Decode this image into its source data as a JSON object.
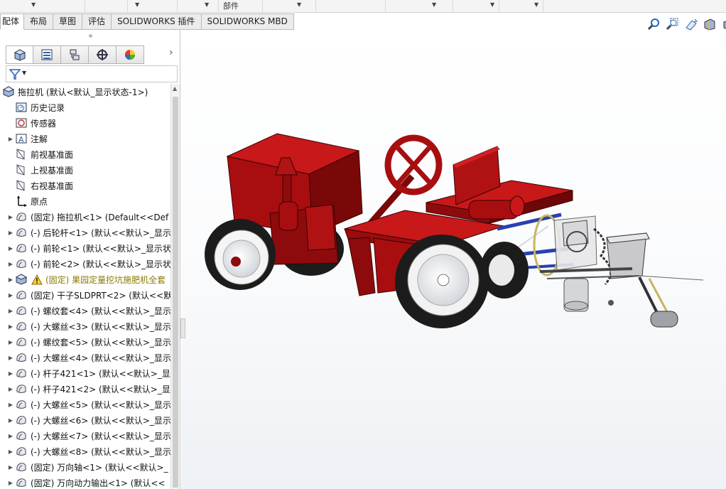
{
  "ribbon": {
    "partial_label": "部件"
  },
  "tabs": [
    "配体",
    "布局",
    "草图",
    "评估",
    "SOLIDWORKS 插件",
    "SOLIDWORKS MBD"
  ],
  "panel_tabs": [
    "feature-manager",
    "property-manager",
    "configuration-manager",
    "dimxpert-manager",
    "display-manager"
  ],
  "tree": [
    {
      "label": "拖拉机  (默认<默认_显示状态-1>)",
      "icon": "assembly-icon",
      "expander": "collapse"
    },
    {
      "label": "历史记录",
      "icon": "history-folder-icon",
      "expander": ""
    },
    {
      "label": "传感器",
      "icon": "sensor-icon",
      "expander": ""
    },
    {
      "label": "注解",
      "icon": "annotation-icon",
      "expander": "expand"
    },
    {
      "label": "前视基准面",
      "icon": "plane-icon",
      "expander": ""
    },
    {
      "label": "上视基准面",
      "icon": "plane-icon",
      "expander": ""
    },
    {
      "label": "右视基准面",
      "icon": "plane-icon",
      "expander": ""
    },
    {
      "label": "原点",
      "icon": "origin-icon",
      "expander": ""
    },
    {
      "label": "(固定) 拖拉机<1> (Default<<Def",
      "icon": "part-icon",
      "expander": "expand"
    },
    {
      "label": "(-) 后轮杆<1> (默认<<默认>_显示",
      "icon": "part-icon",
      "expander": "expand"
    },
    {
      "label": "(-) 前轮<1> (默认<<默认>_显示状",
      "icon": "part-icon",
      "expander": "expand"
    },
    {
      "label": "(-) 前轮<2> (默认<<默认>_显示状",
      "icon": "part-icon",
      "expander": "expand"
    },
    {
      "label": "(固定) 果园定量挖坑施肥机全套",
      "icon": "subassembly-icon",
      "expander": "expand",
      "warning": true
    },
    {
      "label": "(固定) 干子SLDPRT<2> (默认<<默",
      "icon": "part-icon",
      "expander": "expand"
    },
    {
      "label": "(-) 螺纹套<4> (默认<<默认>_显示",
      "icon": "part-icon",
      "expander": "expand"
    },
    {
      "label": "(-) 大螺丝<3> (默认<<默认>_显示",
      "icon": "part-icon",
      "expander": "expand"
    },
    {
      "label": "(-) 螺纹套<5> (默认<<默认>_显示",
      "icon": "part-icon",
      "expander": "expand"
    },
    {
      "label": "(-) 大螺丝<4> (默认<<默认>_显示",
      "icon": "part-icon",
      "expander": "expand"
    },
    {
      "label": "(-) 杆子421<1> (默认<<默认>_显",
      "icon": "part-icon",
      "expander": "expand"
    },
    {
      "label": "(-) 杆子421<2> (默认<<默认>_显",
      "icon": "part-icon",
      "expander": "expand"
    },
    {
      "label": "(-) 大螺丝<5> (默认<<默认>_显示",
      "icon": "part-icon",
      "expander": "expand"
    },
    {
      "label": "(-) 大螺丝<6> (默认<<默认>_显示",
      "icon": "part-icon",
      "expander": "expand"
    },
    {
      "label": "(-) 大螺丝<7> (默认<<默认>_显示",
      "icon": "part-icon",
      "expander": "expand"
    },
    {
      "label": "(-) 大螺丝<8> (默认<<默认>_显示",
      "icon": "part-icon",
      "expander": "expand"
    },
    {
      "label": "(固定) 万向轴<1> (默认<<默认>_",
      "icon": "part-icon",
      "expander": "expand"
    },
    {
      "label": "(固定) 万向动力输出<1> (默认<<",
      "icon": "part-icon",
      "expander": "expand"
    }
  ],
  "view_tools": [
    "zoom-to-fit-icon",
    "zoom-area-icon",
    "previous-view-icon",
    "section-view-icon",
    "view-orientation-icon"
  ],
  "colors": {
    "body_red": "#a80e10",
    "body_red_light": "#c8181a",
    "body_red_dark": "#6e0709",
    "frame_blue": "#2b3fae",
    "tire": "#1c1c1c"
  }
}
